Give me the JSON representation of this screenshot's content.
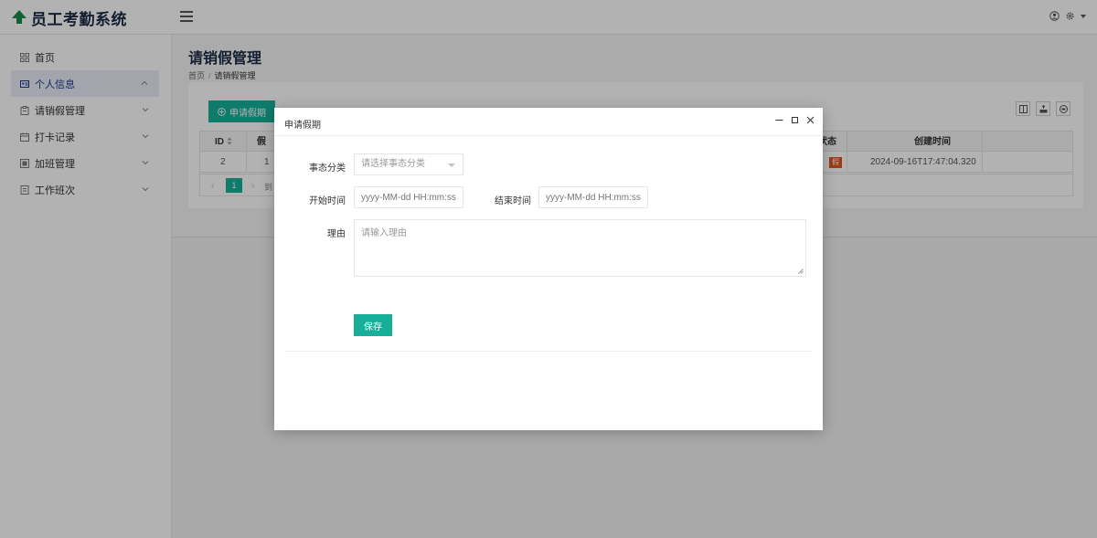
{
  "app": {
    "title": "员工考勤系统"
  },
  "sidebar": {
    "items": [
      {
        "label": "首页",
        "icon": "grid-icon"
      },
      {
        "label": "个人信息",
        "icon": "id-card-icon",
        "active": true
      },
      {
        "label": "请销假管理",
        "icon": "clipboard-icon"
      },
      {
        "label": "打卡记录",
        "icon": "calendar-icon"
      },
      {
        "label": "加班管理",
        "icon": "image-icon"
      },
      {
        "label": "工作班次",
        "icon": "document-icon"
      }
    ]
  },
  "page": {
    "title": "请销假管理",
    "breadcrumb": {
      "home": "首页",
      "separator": "/",
      "current": "请销假管理"
    }
  },
  "toolbar": {
    "apply_label": "申请假期"
  },
  "table": {
    "headers": {
      "id": "ID",
      "type_partial": "假",
      "status_partial": "状态",
      "created": "创建时间"
    },
    "rows": [
      {
        "id": "2",
        "type_partial": "1",
        "status": "假",
        "created": "2024-09-16T17:47:04.320"
      }
    ]
  },
  "pager": {
    "current_page": "1",
    "text_partial": "到"
  },
  "modal": {
    "title": "申请假期",
    "fields": {
      "category": {
        "label": "事态分类",
        "placeholder": "请选择事态分类"
      },
      "start_time": {
        "label": "开始时间",
        "placeholder": "yyyy-MM-dd HH:mm:ss"
      },
      "end_time": {
        "label": "结束时间",
        "placeholder": "yyyy-MM-dd HH:mm:ss"
      },
      "reason": {
        "label": "理由",
        "placeholder": "请输入理由"
      }
    },
    "save_label": "保存"
  },
  "colors": {
    "primary": "#16b09a",
    "status": "#e2551d",
    "title": "#1b2a44",
    "active_nav": "#1d3a8a"
  }
}
